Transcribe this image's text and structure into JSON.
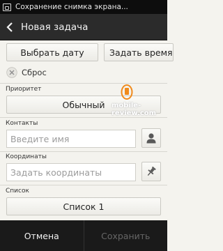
{
  "status_bar": {
    "notification_text": "Сохранение снимка экрана..."
  },
  "header": {
    "title": "Новая задача"
  },
  "actions": {
    "pick_date": "Выбрать дату",
    "set_time": "Задать время"
  },
  "reset": {
    "label": "Сброс"
  },
  "priority": {
    "label": "Приоритет",
    "value": "Обычный"
  },
  "contacts": {
    "label": "Контакты",
    "placeholder": "Введите имя"
  },
  "coordinates": {
    "label": "Координаты",
    "placeholder": "Задать координаты"
  },
  "list": {
    "label": "Список",
    "value": "Список 1"
  },
  "footer": {
    "cancel": "Отмена",
    "save": "Сохранить"
  },
  "watermark": "mobile-review.com",
  "colors": {
    "accent": "#f08a1c",
    "background": "#f4f3ee",
    "bar": "#1a1a1a"
  }
}
